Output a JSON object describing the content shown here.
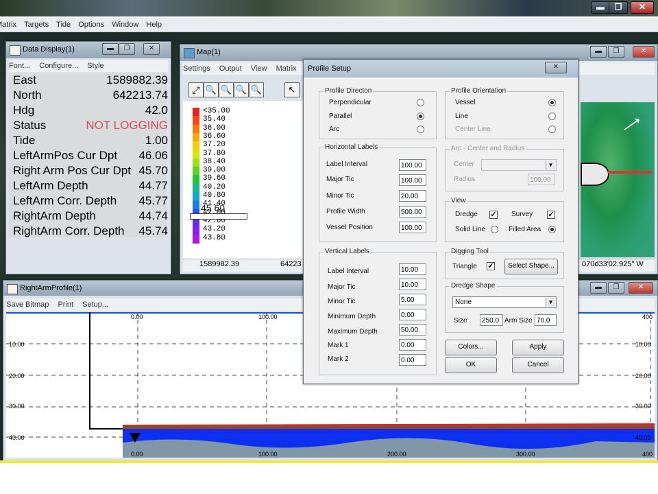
{
  "app": {
    "menu": [
      "Matrix",
      "Targets",
      "Tide",
      "Options",
      "Window",
      "Help"
    ],
    "window_buttons": [
      "▬",
      "❐",
      "✕"
    ]
  },
  "data_display": {
    "title": "Data Display(1)",
    "menu": [
      "Font...",
      "Configure...",
      "Style"
    ],
    "rows": [
      {
        "label": "East",
        "value": "1589882.39"
      },
      {
        "label": "North",
        "value": "642213.74"
      },
      {
        "label": "Hdg",
        "value": "42.0"
      },
      {
        "label": "Status",
        "value": "NOT LOGGING"
      },
      {
        "label": "Tide",
        "value": "1.00"
      },
      {
        "label": "LeftArmPos Cur Dpt",
        "value": "46.06"
      },
      {
        "label": "Right Arm Pos Cur Dpt",
        "value": "45.70"
      },
      {
        "label": "LeftArm Depth",
        "value": "44.77"
      },
      {
        "label": "LeftArm Corr. Depth",
        "value": "45.77"
      },
      {
        "label": "RightArm Depth",
        "value": "44.74"
      },
      {
        "label": "RightArm Corr. Depth",
        "value": "45.74"
      }
    ],
    "status_color": "#e8474f"
  },
  "map": {
    "title": "Map(1)",
    "menu": [
      "Settings",
      "Output",
      "View",
      "Matrix"
    ],
    "legend": [
      "<35.00",
      "35.40",
      "36.00",
      "36.60",
      "37.20",
      "37.80",
      "38.40",
      "39.00",
      "39.60",
      "40.20",
      "40.80",
      "41.40",
      "42.00",
      "42.60",
      "43.20",
      "43.80"
    ],
    "overlay_text": "45 60",
    "status_left": "1589982.39",
    "status_mid": "64223",
    "status_right": "070d33'02.925\" W"
  },
  "profile": {
    "title": "RightArmProfile(1)",
    "menu": [
      "Save Bitmap",
      "Print",
      "Setup..."
    ],
    "y_labels": [
      "10.00",
      "20.00",
      "30.00",
      "40.00"
    ],
    "x_labels_top": [
      "0.00",
      "100.00",
      "400"
    ],
    "x_labels_bottom": [
      "0.00",
      "100.00",
      "200.00",
      "300.00",
      "400"
    ]
  },
  "dialog": {
    "title": "Profile Setup",
    "close": "✕",
    "profile_direction": {
      "title": "Profile Directon",
      "options": [
        "Perpendicular",
        "Parallel",
        "Arc"
      ],
      "selected": 1
    },
    "profile_orientation": {
      "title": "Profile Orientation",
      "options": [
        "Vessel",
        "Line",
        "Center Line"
      ],
      "selected": 0
    },
    "horizontal_labels": {
      "title": "Horizontal Labels",
      "fields": [
        {
          "label": "Label Interval",
          "value": "100.00"
        },
        {
          "label": "Major Tic",
          "value": "100.00"
        },
        {
          "label": "Minor Tic",
          "value": "20.00"
        },
        {
          "label": "Profile Width",
          "value": "500.00"
        },
        {
          "label": "Vessel Position",
          "value": "100.00"
        }
      ]
    },
    "arc": {
      "title": "Arc - Center and Radius",
      "center_label": "Center",
      "radius_label": "Radius",
      "radius_value": "100.00"
    },
    "view": {
      "title": "View",
      "dredge": "Dredge",
      "survey": "Survey",
      "solid_line": "Solid Line",
      "filled_area": "Filled Area",
      "check": "✓"
    },
    "vertical_labels": {
      "title": "Vertical Labels",
      "fields": [
        {
          "label": "Label Interval",
          "value": "10.00"
        },
        {
          "label": "Major Tic",
          "value": "10.00"
        },
        {
          "label": "Minor Tic",
          "value": "5.00"
        },
        {
          "label": "Minimum Depth",
          "value": "0.00"
        },
        {
          "label": "Maximum Depth",
          "value": "50.00"
        },
        {
          "label": "Mark 1",
          "value": "0.00"
        },
        {
          "label": "Mark 2",
          "value": "0.00"
        }
      ]
    },
    "digging_tool": {
      "title": "Digging Tool",
      "triangle": "Triangle",
      "select_shape": "Select Shape..."
    },
    "dredge_shape": {
      "title": "Dredge Shape",
      "shape": "None",
      "size_label": "Size",
      "size_value": "250.0",
      "arm_size_label": "Arm Size",
      "arm_size_value": "70.0"
    },
    "buttons": {
      "colors": "Colors...",
      "apply": "Apply",
      "ok": "OK",
      "cancel": "Cancel"
    }
  }
}
